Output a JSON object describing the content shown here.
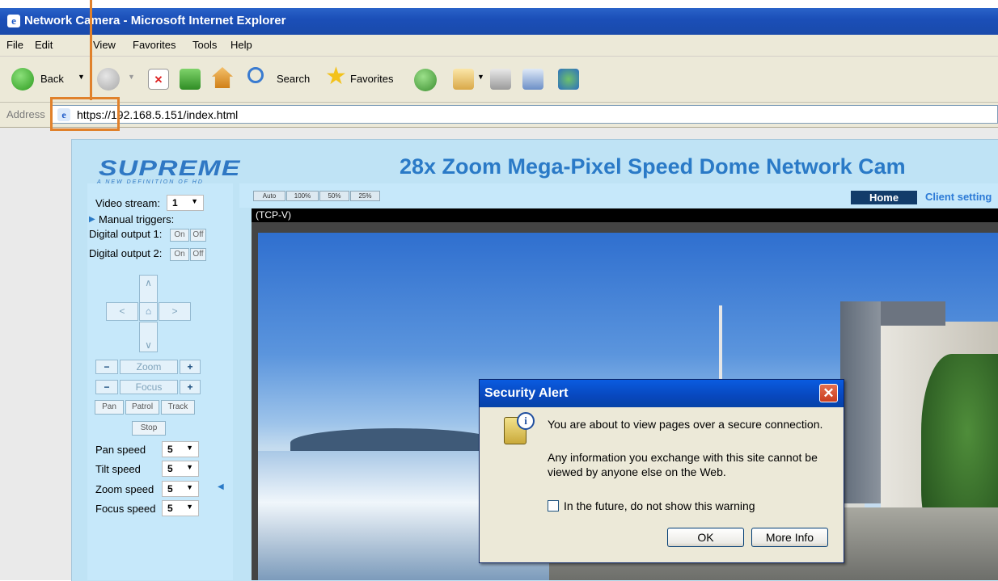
{
  "window": {
    "title": "Network Camera - Microsoft Internet Explorer"
  },
  "menubar": {
    "items": [
      "File",
      "Edit",
      "View",
      "Favorites",
      "Tools",
      "Help"
    ]
  },
  "toolbar": {
    "back_label": "Back",
    "search_label": "Search",
    "favorites_label": "Favorites"
  },
  "address": {
    "label": "Address",
    "url": "https://192.168.5.151/index.html"
  },
  "camera_page": {
    "logo": "SUPREME",
    "logo_tagline": "A NEW DEFINITION OF HD",
    "title": "28x Zoom Mega-Pixel Speed Dome Network Cam",
    "nav": {
      "home": "Home",
      "client_settings": "Client setting"
    },
    "size_buttons": [
      "Auto",
      "100%",
      "50%",
      "25%"
    ],
    "stream_label": "(TCP-V)",
    "left_panel": {
      "video_stream_label": "Video stream:",
      "video_stream_value": "1",
      "manual_triggers_label": "Manual triggers:",
      "digital_output_1": "Digital output 1:",
      "digital_output_2": "Digital output 2:",
      "on_label": "On",
      "off_label": "Off",
      "zoom_label": "Zoom",
      "focus_label": "Focus",
      "minus": "−",
      "plus": "+",
      "pan_button": "Pan",
      "patrol_button": "Patrol",
      "track_button": "Track",
      "stop_button": "Stop",
      "speeds": [
        {
          "label": "Pan speed",
          "value": "5"
        },
        {
          "label": "Tilt speed",
          "value": "5"
        },
        {
          "label": "Zoom speed",
          "value": "5"
        },
        {
          "label": "Focus speed",
          "value": "5"
        }
      ]
    }
  },
  "dialog": {
    "title": "Security Alert",
    "close": "✕",
    "line1": "You are about to view pages over a secure connection.",
    "line2a": "Any information you exchange with this site cannot be",
    "line2b": "viewed by anyone else on the Web.",
    "checkbox_label": "In the future, do not show this warning",
    "ok": "OK",
    "more_info": "More Info"
  },
  "colors": {
    "callout": "#e0812b",
    "title_blue": "#2a7ac7",
    "xp_titlebar": "#1b4fb8"
  }
}
